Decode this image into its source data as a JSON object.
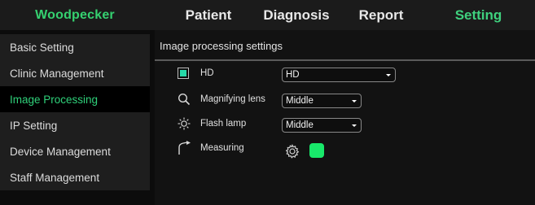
{
  "brand": "Woodpecker",
  "nav": {
    "tabs": [
      "Patient",
      "Diagnosis",
      "Report",
      "Setting"
    ],
    "active_color": "#3fd17e"
  },
  "sidebar": {
    "items": [
      {
        "label": "Basic Setting"
      },
      {
        "label": "Clinic Management"
      },
      {
        "label": "Image Processing"
      },
      {
        "label": "IP Setting"
      },
      {
        "label": "Device Management"
      },
      {
        "label": "Staff Management"
      }
    ],
    "active_index": 2
  },
  "main": {
    "title": "Image processing settings",
    "hd": {
      "label": "HD",
      "value": "HD",
      "icon": "hd-checkbox-icon"
    },
    "magnifier": {
      "label": "Magnifying lens",
      "value": "Middle",
      "icon": "magnifier-icon"
    },
    "flash": {
      "label": "Flash lamp",
      "value": "Middle",
      "icon": "flash-lamp-icon"
    },
    "measuring": {
      "label": "Measuring",
      "icon": "measuring-icon",
      "gear_icon": "gear-icon",
      "swatch_color": "#18e86a"
    }
  }
}
